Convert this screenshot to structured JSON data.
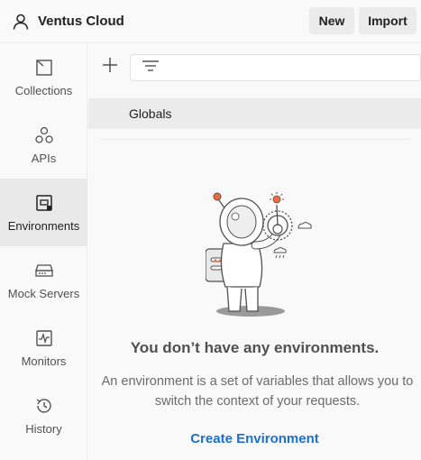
{
  "header": {
    "workspace_name": "Ventus Cloud",
    "new_label": "New",
    "import_label": "Import"
  },
  "sidebar": {
    "items": [
      {
        "label": "Collections",
        "icon": "collections-icon",
        "active": false
      },
      {
        "label": "APIs",
        "icon": "apis-icon",
        "active": false
      },
      {
        "label": "Environments",
        "icon": "environments-icon",
        "active": true
      },
      {
        "label": "Mock Servers",
        "icon": "mock-servers-icon",
        "active": false
      },
      {
        "label": "Monitors",
        "icon": "monitors-icon",
        "active": false
      },
      {
        "label": "History",
        "icon": "history-icon",
        "active": false
      }
    ]
  },
  "main": {
    "globals_label": "Globals",
    "empty_title": "You don’t have any environments.",
    "empty_description": "An environment is a set of variables that allows you to switch the context of your requests.",
    "create_label": "Create Environment"
  },
  "colors": {
    "accent_link": "#1c6fd1",
    "illustration_orange": "#f26b3a",
    "active_bg": "#e9e9e9"
  }
}
